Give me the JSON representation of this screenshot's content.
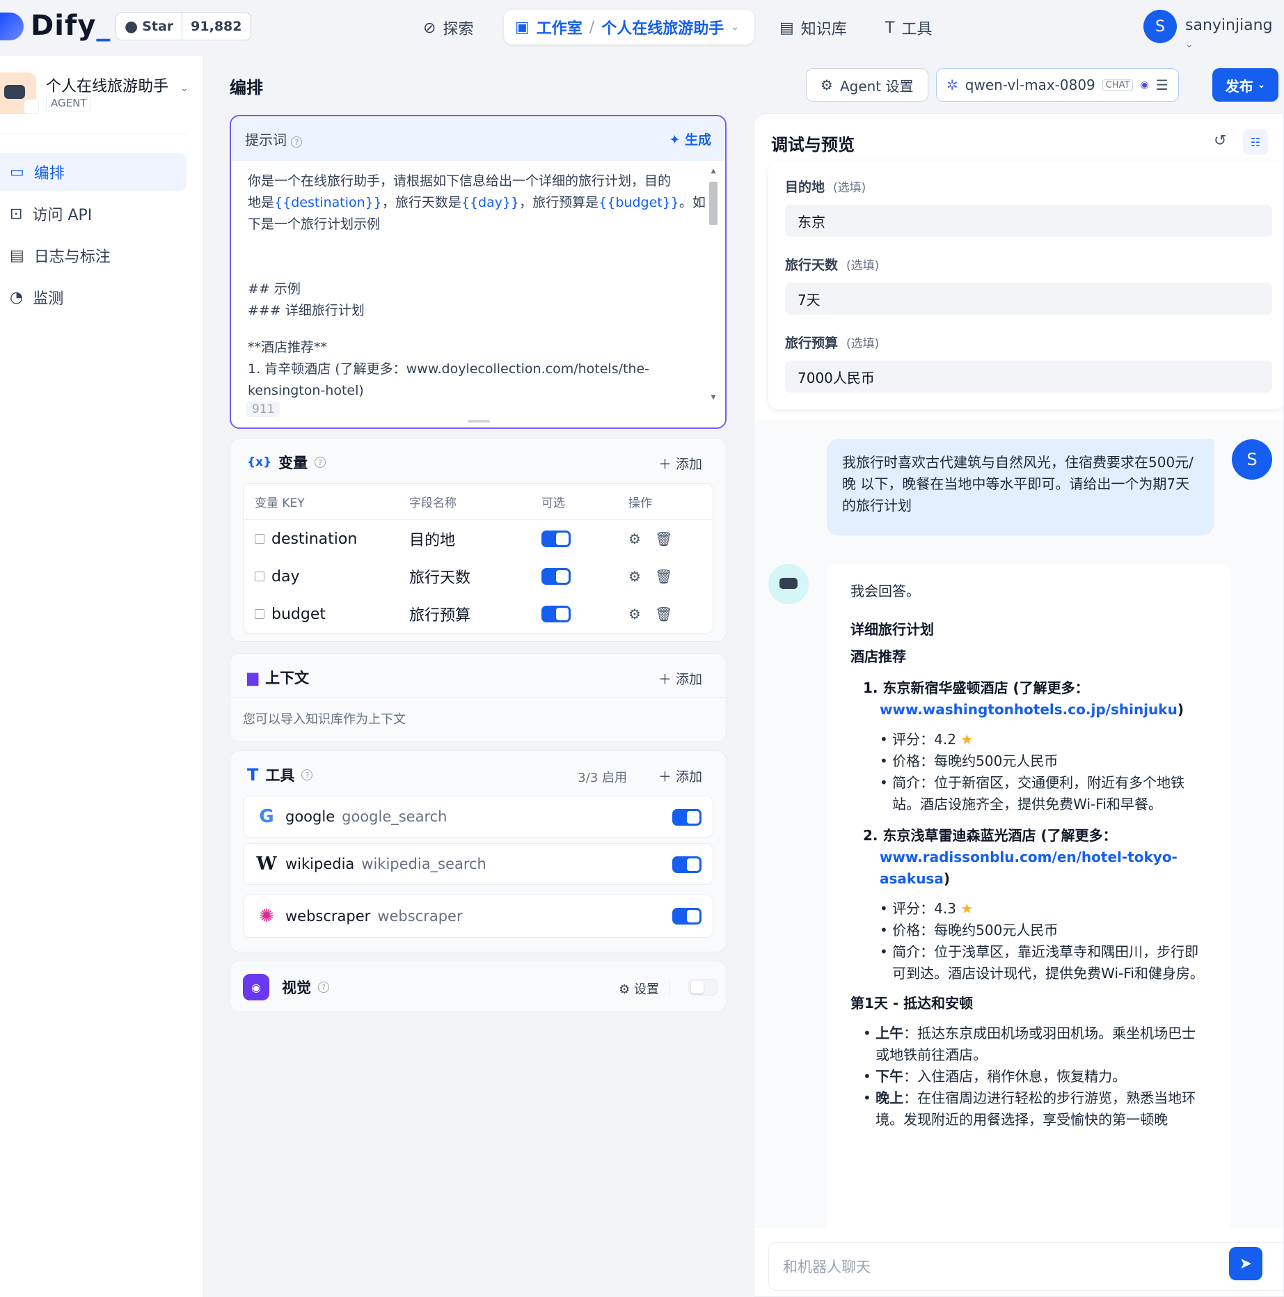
{
  "topbar": {
    "logo": "Dify",
    "star_label": "Star",
    "star_count": "91,882",
    "nav_explore": "探索",
    "nav_studio": "工作室",
    "nav_app": "个人在线旅游助手",
    "nav_knowledge": "知识库",
    "nav_tools": "工具",
    "user_initial": "S",
    "user_name": "sanyinjiang"
  },
  "sidebar": {
    "app_name": "个人在线旅游助手",
    "app_type": "AGENT",
    "items": [
      {
        "label": "编排"
      },
      {
        "label": "访问 API"
      },
      {
        "label": "日志与标注"
      },
      {
        "label": "监测"
      }
    ]
  },
  "orchestrate": {
    "title": "编排",
    "prompt_label": "提示词",
    "generate_label": "生成",
    "prompt_line1": "你是一个在线旅行助手，请根据如下信息给出一个详细的旅行计划，目的",
    "prompt_line2a": "地是",
    "var_destination": "{{destination}}",
    "prompt_line2b": "，旅行天数是",
    "var_day": "{{day}}",
    "prompt_line2c": "，旅行预算是",
    "var_budget": "{{budget}}",
    "prompt_line2d": "。如",
    "prompt_line3": "下是一个旅行计划示例",
    "prompt_line4": "## 示例",
    "prompt_line5": "### 详细旅行计划",
    "prompt_line6": "**酒店推荐**",
    "prompt_line7": "1. 肯辛顿酒店 (了解更多：www.doylecollection.com/hotels/the-",
    "prompt_line8": "kensington-hotel)",
    "prompt_count": "911"
  },
  "variables": {
    "title": "变量",
    "add": "添加",
    "col_key": "变量 KEY",
    "col_name": "字段名称",
    "col_optional": "可选",
    "col_action": "操作",
    "rows": [
      {
        "key": "destination",
        "name": "目的地"
      },
      {
        "key": "day",
        "name": "旅行天数"
      },
      {
        "key": "budget",
        "name": "旅行预算"
      }
    ]
  },
  "context": {
    "title": "上下文",
    "add": "添加",
    "desc": "您可以导入知识库作为上下文"
  },
  "tools": {
    "title": "工具",
    "enabled": "3/3 启用",
    "add": "添加",
    "items": [
      {
        "provider": "google",
        "name": "google_search"
      },
      {
        "provider": "wikipedia",
        "name": "wikipedia_search"
      },
      {
        "provider": "webscraper",
        "name": "webscraper"
      }
    ]
  },
  "vision": {
    "title": "视觉",
    "settings": "设置"
  },
  "header_actions": {
    "agent_settings": "Agent 设置",
    "model": "qwen-vl-max-0809",
    "model_badge": "CHAT",
    "publish": "发布"
  },
  "debug": {
    "title": "调试与预览",
    "optional": "(选填)",
    "fields": [
      {
        "label": "目的地",
        "value": "东京"
      },
      {
        "label": "旅行天数",
        "value": "7天"
      },
      {
        "label": "旅行预算",
        "value": "7000人民币"
      }
    ],
    "user_initial": "S",
    "user_message": "我旅行时喜欢古代建筑与自然风光，住宿费要求在500元/晚 以下，晚餐在当地中等水平即可。请给出一个为期7天的旅行计划",
    "bot": {
      "intro": "我会回答。",
      "h1": "详细旅行计划",
      "h2": "酒店推荐",
      "hotel1_name": "1. 东京新宿华盛顿酒店 (了解更多：",
      "hotel1_link": "www.washingtonhotels.co.jp/shinjuku",
      "hotel1_rating": "评分：4.2",
      "hotel1_price": "价格：每晚约500元人民币",
      "hotel1_desc": "简介：位于新宿区，交通便利，附近有多个地铁站。酒店设施齐全，提供免费Wi-Fi和早餐。",
      "hotel2_name": "2. 东京浅草雷迪森蓝光酒店 (了解更多：",
      "hotel2_link": "www.radissonblu.com/en/hotel-tokyo-asakusa",
      "hotel2_rating": "评分：4.3",
      "hotel2_price": "价格：每晚约500元人民币",
      "hotel2_desc": "简介：位于浅草区，靠近浅草寺和隅田川，步行即可到达。酒店设计现代，提供免费Wi-Fi和健身房。",
      "day1": "第1天 - 抵达和安顿",
      "morning_label": "上午",
      "morning": "：抵达东京成田机场或羽田机场。乘坐机场巴士或地铁前往酒店。",
      "afternoon_label": "下午",
      "afternoon": "：入住酒店，稍作休息，恢复精力。",
      "evening_label": "晚上",
      "evening": "：在住宿周边进行轻松的步行游览，熟悉当地环境。发现附近的用餐选择，享受愉快的第一顿晚"
    },
    "input_placeholder": "和机器人聊天"
  }
}
